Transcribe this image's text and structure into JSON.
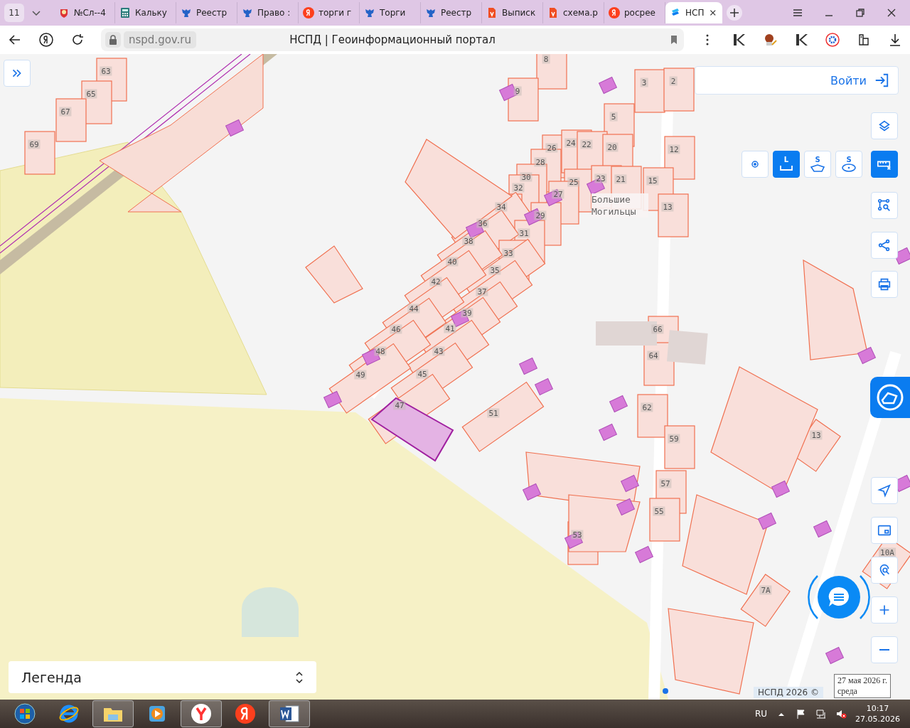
{
  "browser": {
    "tab_counter": "11",
    "tabs": [
      {
        "label": "№Сл--4",
        "kind": "crest",
        "selected": false
      },
      {
        "label": "Кальку",
        "kind": "calculator",
        "selected": false
      },
      {
        "label": "Реестр",
        "kind": "eagle",
        "selected": false
      },
      {
        "label": "Право :",
        "kind": "eagle",
        "selected": false
      },
      {
        "label": "торги г",
        "kind": "yandex",
        "selected": false
      },
      {
        "label": "Торги",
        "kind": "eagle",
        "selected": false
      },
      {
        "label": "Реестр",
        "kind": "eagle",
        "selected": false
      },
      {
        "label": "Выписк",
        "kind": "pdf",
        "selected": false
      },
      {
        "label": "схема.р",
        "kind": "pdf",
        "selected": false
      },
      {
        "label": "росрее",
        "kind": "yandex",
        "selected": false
      },
      {
        "label": "НСП",
        "kind": "nspd",
        "selected": true
      }
    ],
    "address": "nspd.gov.ru",
    "page_title": "НСПД | Геоинформационный портал"
  },
  "map": {
    "house_numbers": [
      "63",
      "65",
      "67",
      "69",
      "8",
      "9",
      "3",
      "2",
      "5",
      "26",
      "24",
      "22",
      "20",
      "12",
      "28",
      "30",
      "32",
      "25",
      "23",
      "21",
      "15",
      "27",
      "13",
      "34",
      "29",
      "36",
      "31",
      "38",
      "33",
      "40",
      "35",
      "42",
      "37",
      "39",
      "44",
      "46",
      "41",
      "66",
      "48",
      "43",
      "64",
      "49",
      "45",
      "47",
      "62",
      "51",
      "59",
      "13",
      "57",
      "55",
      "53",
      "10А",
      "7А"
    ],
    "place_label": "Большие Могильцы",
    "login": "Войти",
    "measure_tools": [
      {
        "kind": "point",
        "selected": false
      },
      {
        "kind": "length",
        "label": "L",
        "selected": true
      },
      {
        "kind": "polygon",
        "label": "S",
        "selected": false
      },
      {
        "kind": "circle",
        "label": "S",
        "selected": false
      }
    ],
    "measure_clear": {
      "active": true
    },
    "legend": {
      "title": "Легенда"
    },
    "attribution": "НСПД 2026 ©"
  },
  "tooltip": {
    "lines": [
      "27 мая 2026 г.",
      "среда"
    ]
  },
  "taskbar": {
    "apps": [
      {
        "kind": "start",
        "running": false
      },
      {
        "kind": "ie",
        "running": false
      },
      {
        "kind": "explorer",
        "running": true
      },
      {
        "kind": "media",
        "running": false
      },
      {
        "kind": "ybrowser",
        "running": true
      },
      {
        "kind": "yandex",
        "running": false
      },
      {
        "kind": "word",
        "running": true
      }
    ],
    "language": "RU",
    "time": "10:17",
    "date": "27.05.2026"
  }
}
